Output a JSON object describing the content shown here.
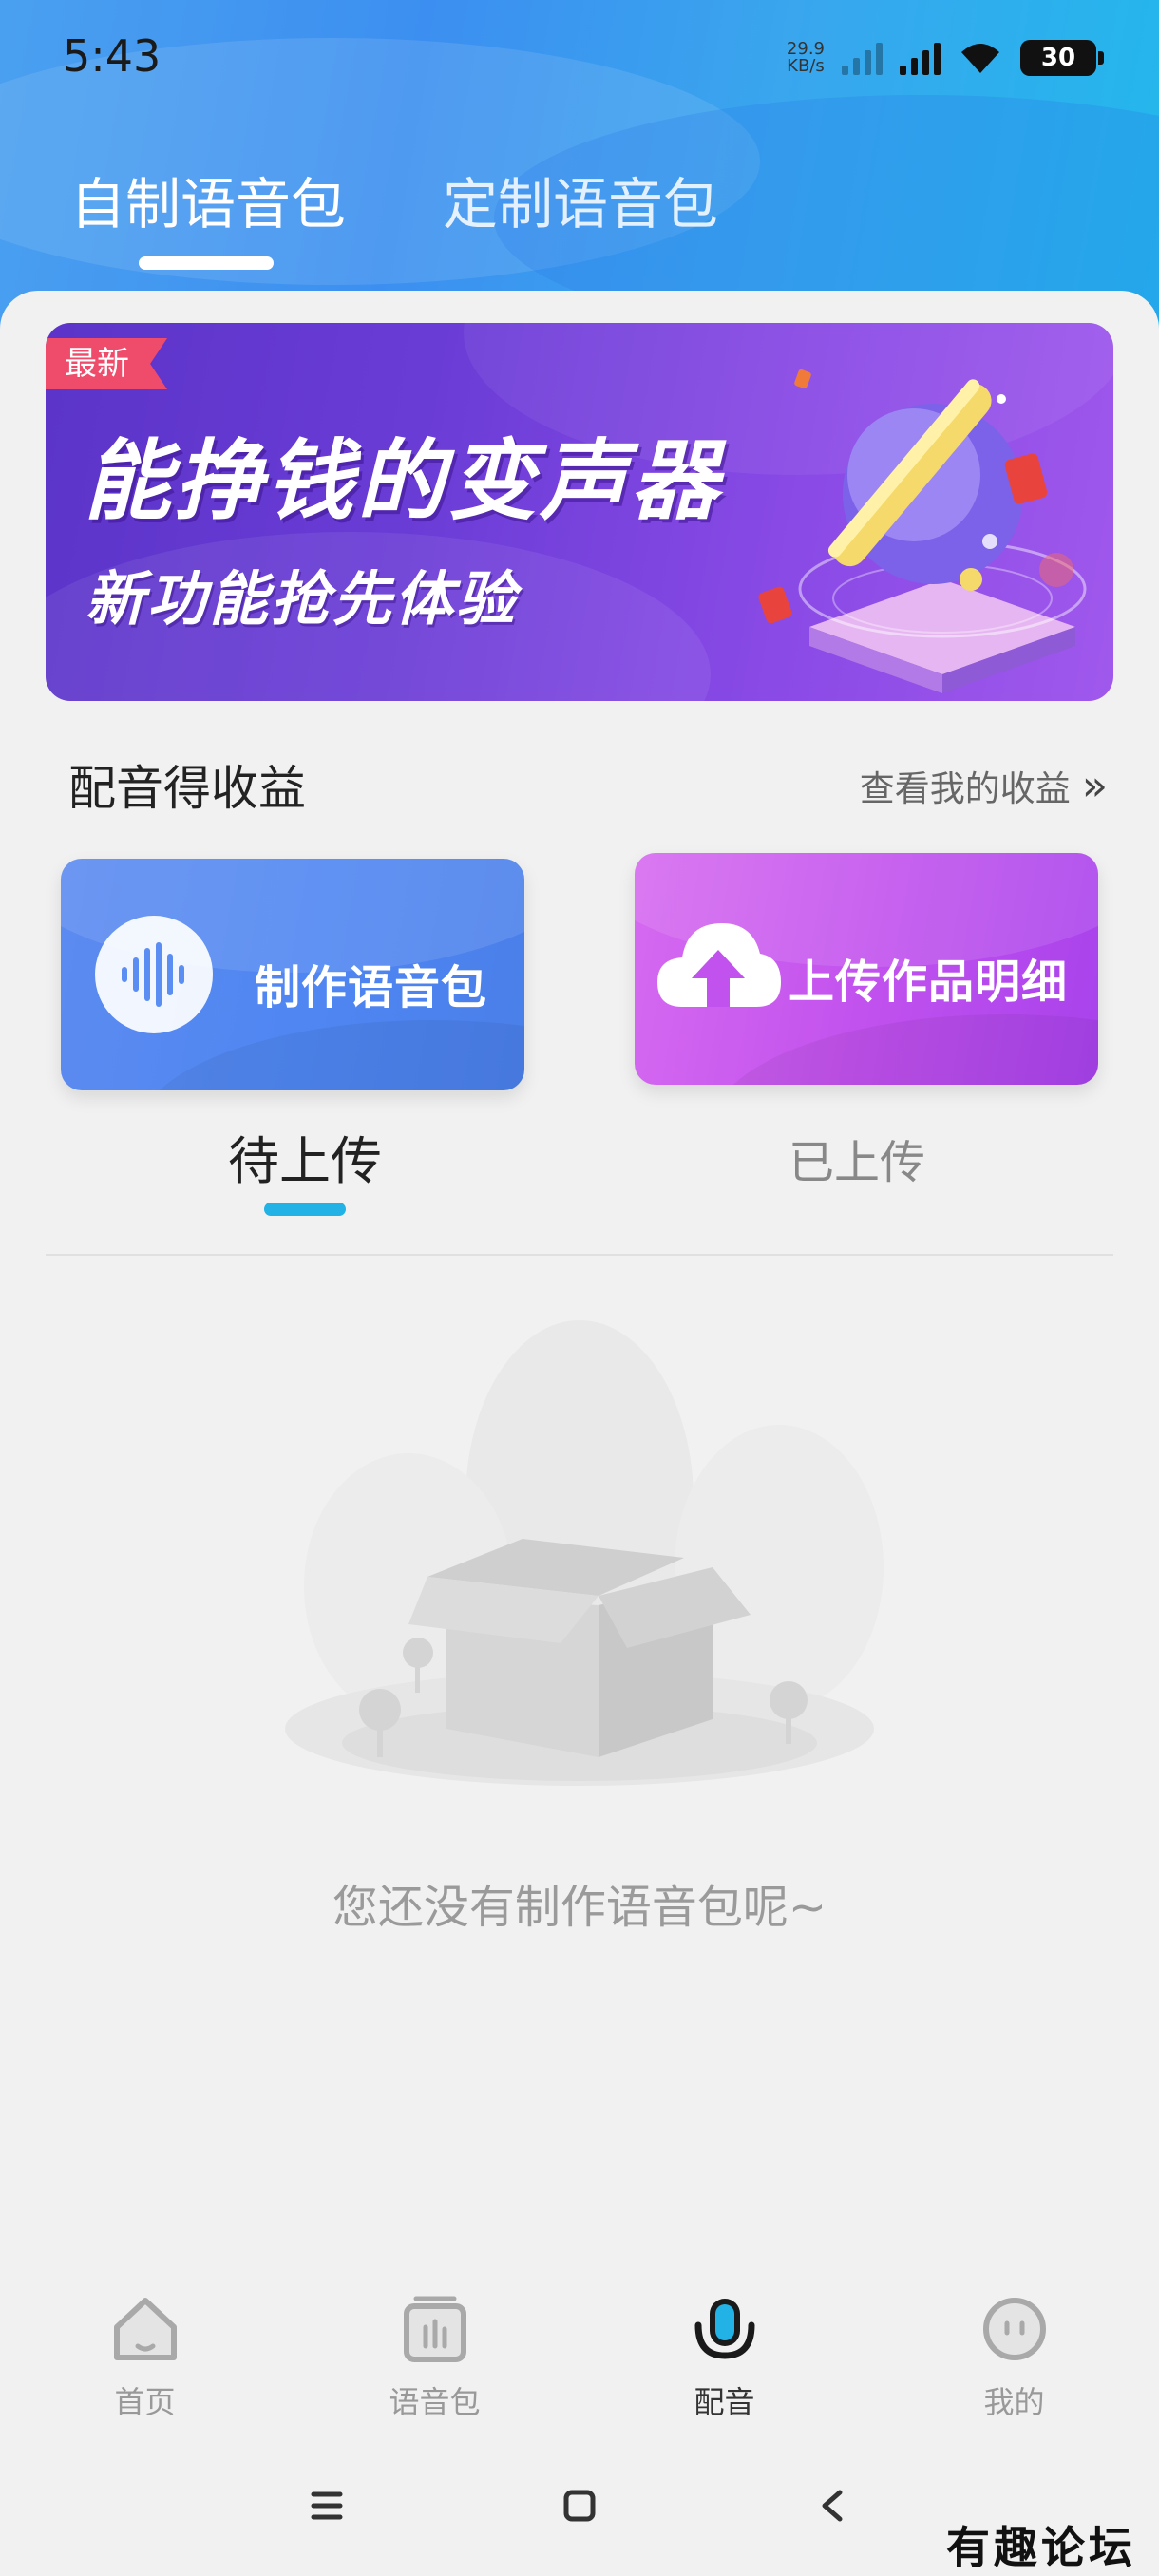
{
  "status_bar": {
    "time": "5:43",
    "net_speed_value": "29.9",
    "net_speed_unit": "KB/s",
    "battery": "30"
  },
  "top_tabs": [
    {
      "label": "自制语音包",
      "active": true
    },
    {
      "label": "定制语音包",
      "active": false
    }
  ],
  "banner": {
    "badge": "最新",
    "title": "能挣钱的变声器",
    "subtitle": "新功能抢先体验"
  },
  "section": {
    "title": "配音得收益",
    "link": "查看我的收益"
  },
  "cards": {
    "make": "制作语音包",
    "upload": "上传作品明细"
  },
  "sub_tabs": [
    {
      "label": "待上传",
      "active": true
    },
    {
      "label": "已上传",
      "active": false
    }
  ],
  "empty_state": {
    "message": "您还没有制作语音包呢~"
  },
  "bottom_nav": [
    {
      "label": "首页",
      "icon": "home-icon",
      "active": false
    },
    {
      "label": "语音包",
      "icon": "voice-pack-icon",
      "active": false
    },
    {
      "label": "配音",
      "icon": "microphone-icon",
      "active": true
    },
    {
      "label": "我的",
      "icon": "profile-icon",
      "active": false
    }
  ],
  "watermark": "有趣论坛",
  "colors": {
    "header_gradient_start": "#4aa0f0",
    "header_gradient_end": "#22b8ec",
    "sub_tab_indicator": "#22b2e6",
    "banner_badge": "#ef4b6b",
    "card_make": "#4f86f2",
    "card_upload": "#c252ee"
  }
}
